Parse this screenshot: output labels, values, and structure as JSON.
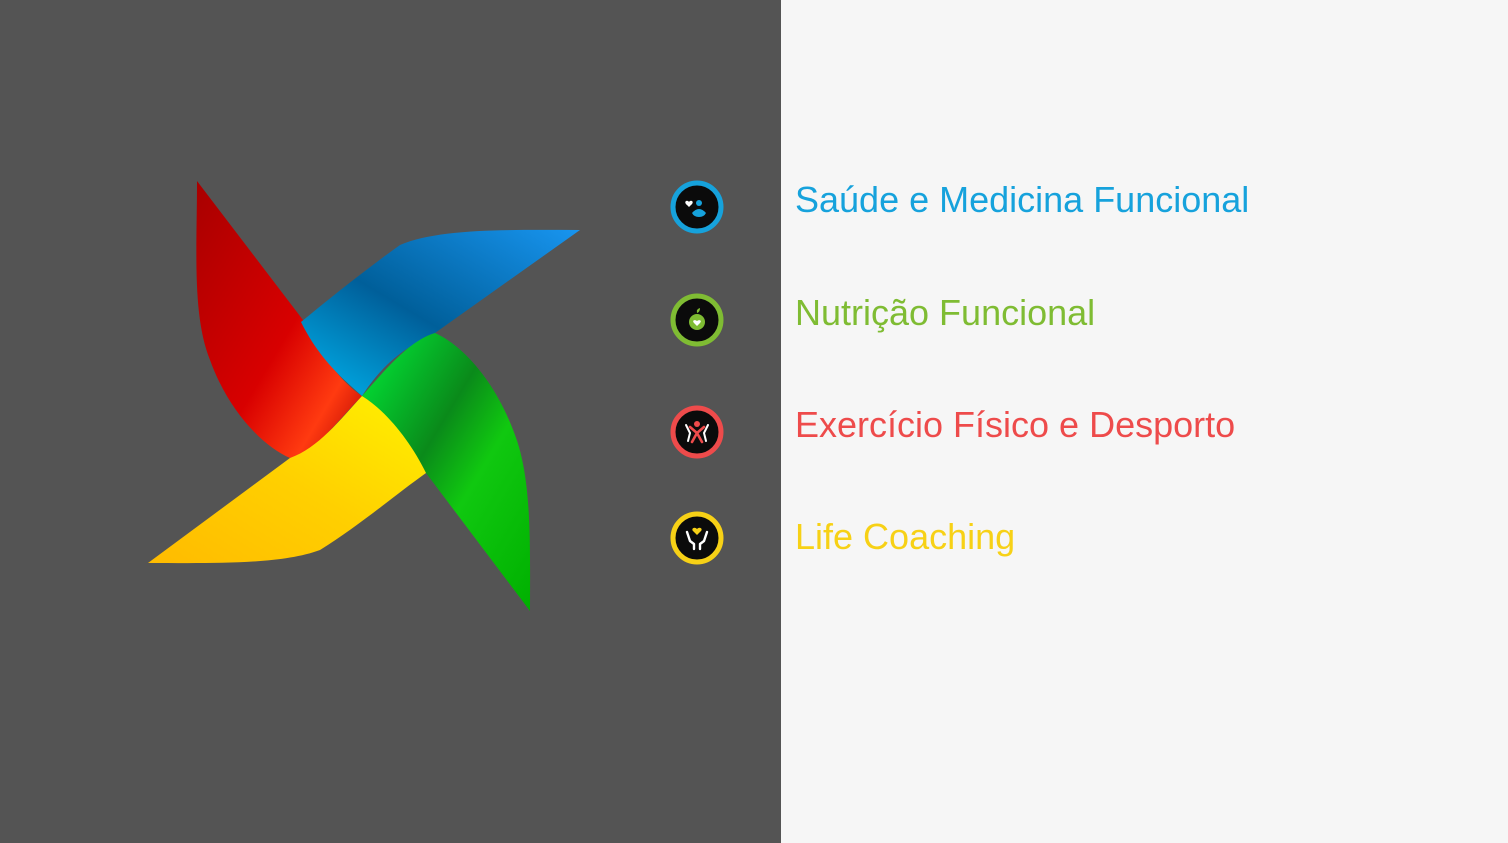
{
  "colors": {
    "left_panel_bg": "#545454",
    "right_panel_bg": "#f6f6f6",
    "icon_inner": "#0b0b0b"
  },
  "pinwheel": {
    "icon": "pinwheel-logo",
    "blade_colors": {
      "red": "#d00000",
      "blue": "#1c8fe0",
      "green": "#1fc21f",
      "yellow": "#ffc800"
    }
  },
  "menu": {
    "items": [
      {
        "label": "Saúde e Medicina Funcional",
        "color": "#16a2dc",
        "icon": "heart-body-icon"
      },
      {
        "label": "Nutrição Funcional",
        "color": "#7fbc33",
        "icon": "apple-heart-icon"
      },
      {
        "label": "Exercício Físico e Desporto",
        "color": "#ee4b4b",
        "icon": "athletes-icon"
      },
      {
        "label": "Life Coaching",
        "color": "#f7d116",
        "icon": "hands-heart-icon"
      }
    ]
  }
}
